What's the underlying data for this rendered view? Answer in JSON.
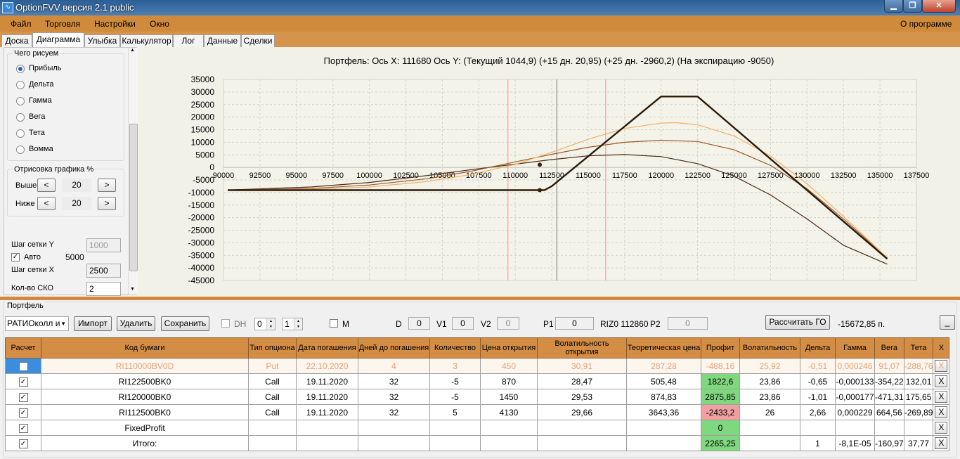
{
  "window": {
    "title": "OptionFVV версия 2.1 public",
    "icon": "chart-app-icon"
  },
  "menu": {
    "items": [
      "Файл",
      "Торговля",
      "Настройки",
      "Окно"
    ],
    "right": "О программе"
  },
  "tabs": [
    "Доска",
    "Диаграмма",
    "Улыбка",
    "Калькулятор",
    "Лог",
    "Данные",
    "Сделки"
  ],
  "active_tab": "Диаграмма",
  "left": {
    "draw_title": "Чего рисуем",
    "options": [
      "Прибыль",
      "Дельта",
      "Гамма",
      "Вега",
      "Тета",
      "Вомма"
    ],
    "selected": "Прибыль",
    "render_title": "Отрисовка графика %",
    "above_label": "Выше",
    "above_value": "20",
    "below_label": "Ниже",
    "below_value": "20",
    "dec": "<",
    "inc": ">",
    "grid_y_label": "Шаг сетки Y",
    "grid_y_value": "1000",
    "auto_label": "Авто",
    "auto_value": "5000",
    "grid_x_label": "Шаг сетки X",
    "grid_x_value": "2500",
    "sko_label": "Кол-во СКО",
    "sko_value": "2"
  },
  "chart_title": "Портфель: Ось X: 111680 Ось Y:  (Текущий 1044,9)  (+15 дн. 20,95)  (+25 дн. -2960,2)  (На экспирацию -9050)",
  "chart_data": {
    "type": "line",
    "xlim": [
      90000,
      137500
    ],
    "ylim": [
      -45000,
      35000
    ],
    "x_ticks": [
      "90000",
      "92500",
      "95000",
      "97500",
      "100000",
      "102500",
      "105000",
      "107500",
      "110000",
      "112500",
      "115000",
      "117500",
      "120000",
      "122500",
      "125000",
      "127500",
      "130000",
      "132500",
      "135000",
      "137500"
    ],
    "y_ticks": [
      "35000",
      "30000",
      "25000",
      "20000",
      "15000",
      "10000",
      "5000",
      "0",
      "-5000",
      "-10000",
      "-15000",
      "-20000",
      "-25000",
      "-30000",
      "-35000",
      "-40000",
      "-45000"
    ],
    "grid": true,
    "vlines": [
      {
        "x": 109500,
        "color": "#f0a0a0"
      },
      {
        "x": 112850,
        "color": "#8a8a8a"
      },
      {
        "x": 116200,
        "color": "#f0a0a0"
      }
    ],
    "markers": [
      {
        "x": 111680,
        "y": 1045
      },
      {
        "x": 111680,
        "y": -9050
      }
    ],
    "series": [
      {
        "color": "#2b1a08",
        "width": 2.4,
        "x": [
          90300,
          112000,
          112500,
          120000,
          122500,
          135500
        ],
        "y": [
          -9050,
          -9050,
          -7500,
          28200,
          28200,
          -36400
        ]
      },
      {
        "color": "#f5b060",
        "width": 1.2,
        "x": [
          90300,
          96000,
          100000,
          104000,
          107000,
          110000,
          112500,
          115000,
          117500,
          120000,
          121000,
          122500,
          125000,
          127500,
          130000,
          132500,
          135500
        ],
        "y": [
          -9000,
          -8700,
          -7800,
          -5600,
          -2800,
          1200,
          6000,
          11200,
          15500,
          17600,
          17800,
          17000,
          12500,
          4500,
          -6500,
          -19500,
          -36000
        ]
      },
      {
        "color": "#9e5a28",
        "width": 1.2,
        "x": [
          90300,
          96000,
          100000,
          104000,
          107000,
          110000,
          112500,
          115000,
          117500,
          120000,
          122500,
          125000,
          127500,
          130000,
          132500,
          135500
        ],
        "y": [
          -9000,
          -8400,
          -7000,
          -4500,
          -1500,
          2200,
          5200,
          8000,
          10000,
          10800,
          10300,
          7000,
          800,
          -8500,
          -20500,
          -36000
        ]
      },
      {
        "color": "#4a2a12",
        "width": 1.2,
        "x": [
          90300,
          96000,
          100000,
          104000,
          107000,
          110000,
          112500,
          115000,
          117500,
          120000,
          122500,
          125000,
          127500,
          130000,
          132500,
          135500
        ],
        "y": [
          -9000,
          -7800,
          -6000,
          -3200,
          -900,
          1300,
          3100,
          4600,
          5100,
          4300,
          1500,
          -3500,
          -11000,
          -20500,
          -31000,
          -38500
        ]
      }
    ]
  },
  "portfolio": {
    "group_title": "Портфель",
    "select_value": "РАТИОколл и",
    "buttons": {
      "import": "Импорт",
      "delete": "Удалить",
      "save": "Сохранить",
      "calc_go": "Рассчитать ГО",
      "minimize": "_"
    },
    "dh_label": "DH",
    "spin1": "0",
    "spin2": "1",
    "m_label": "M",
    "d_label": "D",
    "d_value": "0",
    "v1_label": "V1",
    "v1_value": "0",
    "v2_label": "V2",
    "v2_value": "0",
    "p1_label": "P1",
    "p1_value": "0",
    "riz_label": "RIZ0 112860",
    "p2_label": "P2",
    "p2_value": "0",
    "go_value": "-15672,85 п.",
    "columns": [
      "Расчет",
      "Код бумаги",
      "Тип опциона",
      "Дата погашения",
      "Дней до погашения",
      "Количество",
      "Цена открытия",
      "Волатильность открытия",
      "Теоретическая цена",
      "Профит",
      "Волатильность",
      "Дельта",
      "Гамма",
      "Вега",
      "Тета",
      "X"
    ],
    "rows": [
      {
        "check": false,
        "code": "RI110000BV0D",
        "type": "Put",
        "date": "22.10.2020",
        "days": "4",
        "qty": "3",
        "price": "450",
        "vol_open": "30,91",
        "theor": "287,28",
        "profit": "-488,16",
        "vol": "25,92",
        "delta": "-0,51",
        "gamma": "0,000246",
        "vega": "91,07",
        "theta": "-288,76",
        "x": "X"
      },
      {
        "check": true,
        "code": "RI122500BK0",
        "type": "Call",
        "date": "19.11.2020",
        "days": "32",
        "qty": "-5",
        "price": "870",
        "vol_open": "28,47",
        "theor": "505,48",
        "profit": "1822,6",
        "vol": "23,86",
        "delta": "-0,65",
        "gamma": "-0,000133",
        "vega": "-354,22",
        "theta": "132,01",
        "x": "X"
      },
      {
        "check": true,
        "code": "RI120000BK0",
        "type": "Call",
        "date": "19.11.2020",
        "days": "32",
        "qty": "-5",
        "price": "1450",
        "vol_open": "29,53",
        "theor": "874,83",
        "profit": "2875,85",
        "vol": "23,86",
        "delta": "-1,01",
        "gamma": "-0,000177",
        "vega": "-471,31",
        "theta": "175,65",
        "x": "X"
      },
      {
        "check": true,
        "code": "RI112500BK0",
        "type": "Call",
        "date": "19.11.2020",
        "days": "32",
        "qty": "5",
        "price": "4130",
        "vol_open": "29,66",
        "theor": "3643,36",
        "profit": "-2433,2",
        "vol": "26",
        "delta": "2,66",
        "gamma": "0,000229",
        "vega": "664,56",
        "theta": "-269,89",
        "x": "X"
      },
      {
        "check": true,
        "code": "FixedProfit",
        "type": "",
        "date": "",
        "days": "",
        "qty": "",
        "price": "",
        "vol_open": "",
        "theor": "",
        "profit": "0",
        "vol": "",
        "delta": "",
        "gamma": "",
        "vega": "",
        "theta": "",
        "x": "X"
      },
      {
        "check": true,
        "code": "Итого:",
        "type": "",
        "date": "",
        "days": "",
        "qty": "",
        "price": "",
        "vol_open": "",
        "theor": "",
        "profit": "2265,25",
        "vol": "",
        "delta": "1",
        "gamma": "-8,1E-05",
        "vega": "-160,97",
        "theta": "37,77",
        "x": "X"
      }
    ]
  }
}
